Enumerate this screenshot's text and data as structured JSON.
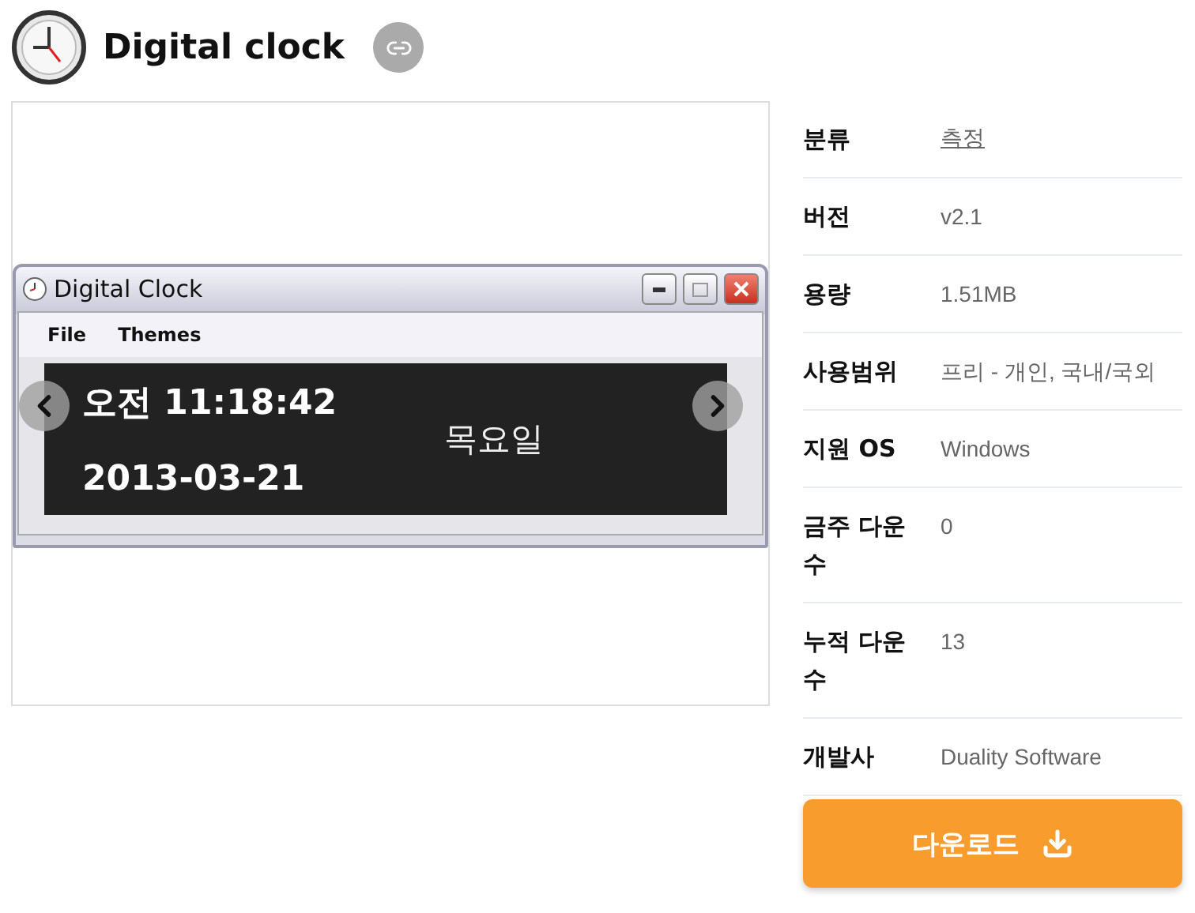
{
  "header": {
    "title": "Digital clock"
  },
  "gallery": {
    "window": {
      "title": "Digital Clock",
      "menu": [
        "File",
        "Themes"
      ],
      "time": "오전 11:18:42",
      "date": "2013-03-21",
      "weekday": "목요일"
    }
  },
  "info": [
    {
      "label": "분류",
      "value": "측정",
      "kind": "link"
    },
    {
      "label": "버전",
      "value": "v2.1",
      "kind": "text"
    },
    {
      "label": "용량",
      "value": "1.51MB",
      "kind": "text"
    },
    {
      "label": "사용범위",
      "value": "프리 - 개인, 국내/국외",
      "kind": "text"
    },
    {
      "label": "지원 OS",
      "value": "Windows",
      "kind": "text"
    },
    {
      "label": "금주 다운수",
      "value": "0",
      "kind": "text"
    },
    {
      "label": "누적 다운수",
      "value": "13",
      "kind": "text"
    },
    {
      "label": "개발사",
      "value": "Duality Software",
      "kind": "text"
    }
  ],
  "download_button": {
    "label": "다운로드"
  }
}
